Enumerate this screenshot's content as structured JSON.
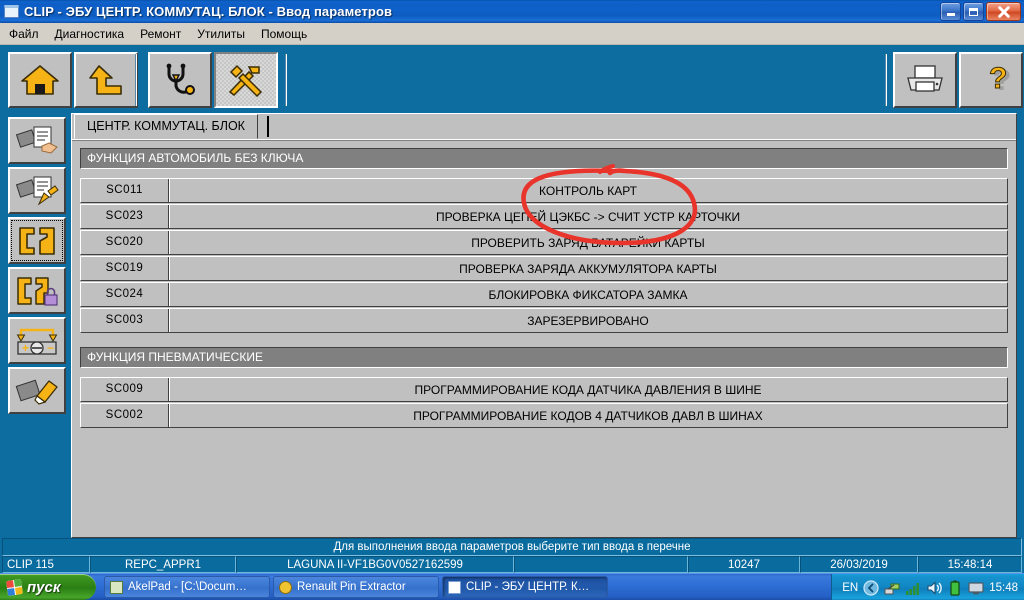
{
  "window": {
    "title": "CLIP - ЭБУ ЦЕНТР. КОММУТАЦ. БЛОК - Ввод параметров",
    "icon": "window-icon",
    "minimize_label": "Свернуть",
    "maximize_label": "Развернуть",
    "close_label": "Закрыть"
  },
  "menu": {
    "items": [
      {
        "label": "Файл"
      },
      {
        "label": "Диагностика"
      },
      {
        "label": "Ремонт"
      },
      {
        "label": "Утилиты"
      },
      {
        "label": "Помощь"
      }
    ]
  },
  "toolbar": {
    "left_buttons": [
      {
        "name": "home-button",
        "icon": "home-icon",
        "active": false
      },
      {
        "name": "back-up-button",
        "icon": "arrow-up-icon",
        "active": false
      },
      {
        "name": "diagnostics-button",
        "icon": "stethoscope-icon",
        "active": false
      },
      {
        "name": "tools-button",
        "icon": "tools-icon",
        "active": true
      }
    ],
    "right_buttons": [
      {
        "name": "print-button",
        "icon": "printer-icon"
      },
      {
        "name": "help-button",
        "icon": "question-mark-icon"
      }
    ]
  },
  "sidebar": {
    "items": [
      {
        "name": "sidebar-item-read-config",
        "icon": "chip-read-icon",
        "active": false
      },
      {
        "name": "sidebar-item-write-config",
        "icon": "chip-write-icon",
        "active": false
      },
      {
        "name": "sidebar-item-parameter-entry",
        "icon": "chip-connector-icon",
        "active": true
      },
      {
        "name": "sidebar-item-locked-config",
        "icon": "chip-lock-icon",
        "active": false
      },
      {
        "name": "sidebar-item-battery",
        "icon": "battery-icon",
        "active": false
      },
      {
        "name": "sidebar-item-chip-erase",
        "icon": "chip-erase-icon",
        "active": false
      }
    ]
  },
  "tab": {
    "label": "ЦЕНТР. КОММУТАЦ. БЛОК"
  },
  "sections": [
    {
      "header": "ФУНКЦИЯ АВТОМОБИЛЬ БЕЗ КЛЮЧА",
      "rows": [
        {
          "code": "SC011",
          "label": "КОНТРОЛЬ КАРТ"
        },
        {
          "code": "SC023",
          "label": "ПРОВЕРКА ЦЕПЕЙ ЦЭКБС -> СЧИТ УСТР КАРТОЧКИ"
        },
        {
          "code": "SC020",
          "label": "ПРОВЕРИТЬ ЗАРЯД БАТАРЕЙКИ КАРТЫ"
        },
        {
          "code": "SC019",
          "label": "ПРОВЕРКА ЗАРЯДА АККУМУЛЯТОРА КАРТЫ"
        },
        {
          "code": "SC024",
          "label": "БЛОКИРОВКА ФИКСАТОРА ЗАМКА"
        },
        {
          "code": "SC003",
          "label": "ЗАРЕЗЕРВИРОВАНО"
        }
      ]
    },
    {
      "header": "ФУНКЦИЯ ПНЕВМАТИЧЕСКИЕ",
      "rows": [
        {
          "code": "SC009",
          "label": "ПРОГРАММИРОВАНИЕ КОДА ДАТЧИКА ДАВЛЕНИЯ В ШИНЕ"
        },
        {
          "code": "SC002",
          "label": "ПРОГРАММИРОВАНИЕ КОДОВ 4 ДАТЧИКОВ ДАВЛ В ШИНАХ"
        }
      ]
    }
  ],
  "message_bar": {
    "text": "Для выполнения ввода параметров выберите тип ввода в перечне"
  },
  "status_bar": {
    "app_version": "CLIP 115",
    "profile": "REPC_APPR1",
    "vehicle": "LAGUNA II-VF1BG0V0527162599",
    "spacer": "",
    "counter": "10247",
    "date": "26/03/2019",
    "time": "15:48:14"
  },
  "annotation": {
    "shape": "red-ellipse",
    "color": "#e8342a"
  },
  "taskbar": {
    "start_label": "пуск",
    "buttons": [
      {
        "name": "taskbar-item-akelpad",
        "label": "AkelPad - [C:\\Docum…",
        "icon": "notepad-icon",
        "active": false
      },
      {
        "name": "taskbar-item-renault-pin-extractor",
        "label": "Renault Pin Extractor",
        "icon": "coin-icon",
        "active": false
      },
      {
        "name": "taskbar-item-clip",
        "label": "CLIP - ЭБУ ЦЕНТР. К…",
        "icon": "window-icon",
        "active": true
      }
    ],
    "tray": {
      "language": "EN",
      "icons": [
        "chevron-left-icon",
        "network-icon",
        "signal-icon",
        "volume-icon",
        "battery-icon",
        "display-icon"
      ],
      "clock": "15:48"
    }
  },
  "colors": {
    "desktop": "#0d6ca0",
    "panel": "#c0c0c0",
    "section_header": "#808080",
    "status_bar": "#0a6b9e",
    "title_bar": "#0e5dc4",
    "accent_yellow": "#f5b316",
    "annotation_red": "#e8342a"
  }
}
